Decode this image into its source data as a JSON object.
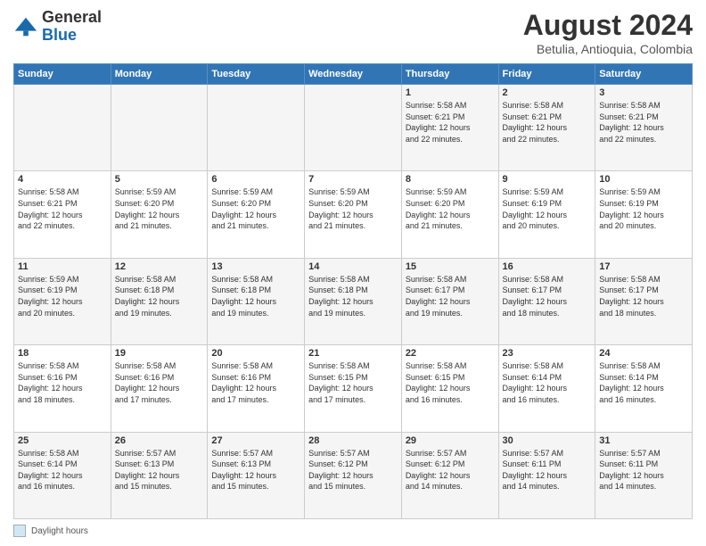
{
  "header": {
    "logo_general": "General",
    "logo_blue": "Blue",
    "main_title": "August 2024",
    "sub_title": "Betulia, Antioquia, Colombia"
  },
  "days_of_week": [
    "Sunday",
    "Monday",
    "Tuesday",
    "Wednesday",
    "Thursday",
    "Friday",
    "Saturday"
  ],
  "weeks": [
    [
      {
        "day": "",
        "info": ""
      },
      {
        "day": "",
        "info": ""
      },
      {
        "day": "",
        "info": ""
      },
      {
        "day": "",
        "info": ""
      },
      {
        "day": "1",
        "info": "Sunrise: 5:58 AM\nSunset: 6:21 PM\nDaylight: 12 hours\nand 22 minutes."
      },
      {
        "day": "2",
        "info": "Sunrise: 5:58 AM\nSunset: 6:21 PM\nDaylight: 12 hours\nand 22 minutes."
      },
      {
        "day": "3",
        "info": "Sunrise: 5:58 AM\nSunset: 6:21 PM\nDaylight: 12 hours\nand 22 minutes."
      }
    ],
    [
      {
        "day": "4",
        "info": "Sunrise: 5:58 AM\nSunset: 6:21 PM\nDaylight: 12 hours\nand 22 minutes."
      },
      {
        "day": "5",
        "info": "Sunrise: 5:59 AM\nSunset: 6:20 PM\nDaylight: 12 hours\nand 21 minutes."
      },
      {
        "day": "6",
        "info": "Sunrise: 5:59 AM\nSunset: 6:20 PM\nDaylight: 12 hours\nand 21 minutes."
      },
      {
        "day": "7",
        "info": "Sunrise: 5:59 AM\nSunset: 6:20 PM\nDaylight: 12 hours\nand 21 minutes."
      },
      {
        "day": "8",
        "info": "Sunrise: 5:59 AM\nSunset: 6:20 PM\nDaylight: 12 hours\nand 21 minutes."
      },
      {
        "day": "9",
        "info": "Sunrise: 5:59 AM\nSunset: 6:19 PM\nDaylight: 12 hours\nand 20 minutes."
      },
      {
        "day": "10",
        "info": "Sunrise: 5:59 AM\nSunset: 6:19 PM\nDaylight: 12 hours\nand 20 minutes."
      }
    ],
    [
      {
        "day": "11",
        "info": "Sunrise: 5:59 AM\nSunset: 6:19 PM\nDaylight: 12 hours\nand 20 minutes."
      },
      {
        "day": "12",
        "info": "Sunrise: 5:58 AM\nSunset: 6:18 PM\nDaylight: 12 hours\nand 19 minutes."
      },
      {
        "day": "13",
        "info": "Sunrise: 5:58 AM\nSunset: 6:18 PM\nDaylight: 12 hours\nand 19 minutes."
      },
      {
        "day": "14",
        "info": "Sunrise: 5:58 AM\nSunset: 6:18 PM\nDaylight: 12 hours\nand 19 minutes."
      },
      {
        "day": "15",
        "info": "Sunrise: 5:58 AM\nSunset: 6:17 PM\nDaylight: 12 hours\nand 19 minutes."
      },
      {
        "day": "16",
        "info": "Sunrise: 5:58 AM\nSunset: 6:17 PM\nDaylight: 12 hours\nand 18 minutes."
      },
      {
        "day": "17",
        "info": "Sunrise: 5:58 AM\nSunset: 6:17 PM\nDaylight: 12 hours\nand 18 minutes."
      }
    ],
    [
      {
        "day": "18",
        "info": "Sunrise: 5:58 AM\nSunset: 6:16 PM\nDaylight: 12 hours\nand 18 minutes."
      },
      {
        "day": "19",
        "info": "Sunrise: 5:58 AM\nSunset: 6:16 PM\nDaylight: 12 hours\nand 17 minutes."
      },
      {
        "day": "20",
        "info": "Sunrise: 5:58 AM\nSunset: 6:16 PM\nDaylight: 12 hours\nand 17 minutes."
      },
      {
        "day": "21",
        "info": "Sunrise: 5:58 AM\nSunset: 6:15 PM\nDaylight: 12 hours\nand 17 minutes."
      },
      {
        "day": "22",
        "info": "Sunrise: 5:58 AM\nSunset: 6:15 PM\nDaylight: 12 hours\nand 16 minutes."
      },
      {
        "day": "23",
        "info": "Sunrise: 5:58 AM\nSunset: 6:14 PM\nDaylight: 12 hours\nand 16 minutes."
      },
      {
        "day": "24",
        "info": "Sunrise: 5:58 AM\nSunset: 6:14 PM\nDaylight: 12 hours\nand 16 minutes."
      }
    ],
    [
      {
        "day": "25",
        "info": "Sunrise: 5:58 AM\nSunset: 6:14 PM\nDaylight: 12 hours\nand 16 minutes."
      },
      {
        "day": "26",
        "info": "Sunrise: 5:57 AM\nSunset: 6:13 PM\nDaylight: 12 hours\nand 15 minutes."
      },
      {
        "day": "27",
        "info": "Sunrise: 5:57 AM\nSunset: 6:13 PM\nDaylight: 12 hours\nand 15 minutes."
      },
      {
        "day": "28",
        "info": "Sunrise: 5:57 AM\nSunset: 6:12 PM\nDaylight: 12 hours\nand 15 minutes."
      },
      {
        "day": "29",
        "info": "Sunrise: 5:57 AM\nSunset: 6:12 PM\nDaylight: 12 hours\nand 14 minutes."
      },
      {
        "day": "30",
        "info": "Sunrise: 5:57 AM\nSunset: 6:11 PM\nDaylight: 12 hours\nand 14 minutes."
      },
      {
        "day": "31",
        "info": "Sunrise: 5:57 AM\nSunset: 6:11 PM\nDaylight: 12 hours\nand 14 minutes."
      }
    ]
  ],
  "footer": {
    "legend_label": "Daylight hours"
  }
}
